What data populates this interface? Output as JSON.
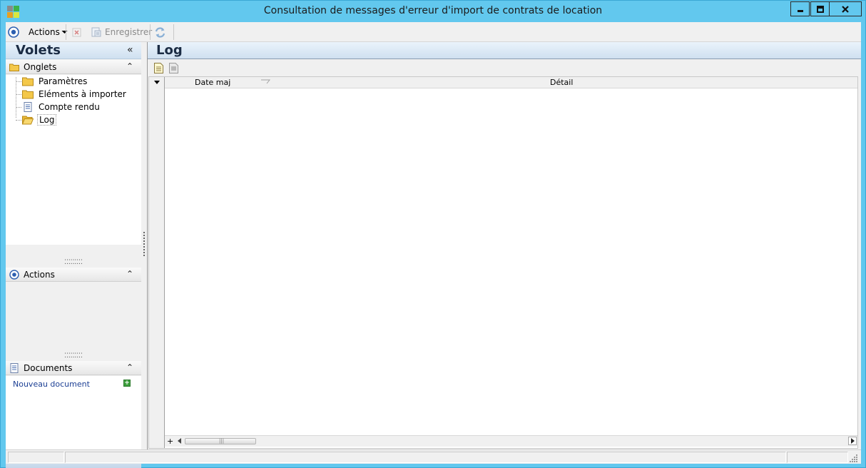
{
  "window": {
    "title": "Consultation de messages d'erreur d'import de contrats de location"
  },
  "toolbar": {
    "actions_label": "Actions",
    "save_label": "Enregistrer"
  },
  "left_pane": {
    "title": "Volets",
    "onglets": {
      "label": "Onglets",
      "items": [
        {
          "label": "Paramètres",
          "icon": "folder-icon"
        },
        {
          "label": "Eléments à importer",
          "icon": "folder-icon"
        },
        {
          "label": "Compte rendu",
          "icon": "document-icon"
        },
        {
          "label": "Log",
          "icon": "open-folder-icon",
          "selected": true
        }
      ]
    },
    "actions": {
      "label": "Actions"
    },
    "documents": {
      "label": "Documents",
      "new_document": "Nouveau document"
    }
  },
  "main": {
    "title": "Log",
    "grid": {
      "columns": [
        "Date maj",
        "Détail"
      ]
    }
  },
  "colors": {
    "frame": "#62c8ee",
    "header_gradient_top": "#eaf3fb",
    "header_gradient_bottom": "#cfe0f0",
    "link": "#1c3f94"
  }
}
